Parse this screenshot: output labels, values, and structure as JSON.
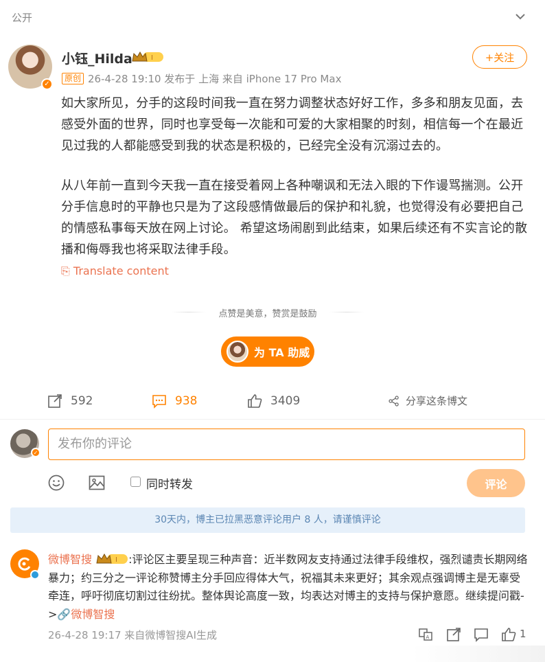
{
  "header": {
    "visibility": "公开"
  },
  "post": {
    "author": "小钰_Hilda",
    "follow_label": "+关注",
    "original_tag": "原创",
    "meta": "26-4-28 19:10  发布于 上海  来自 iPhone 17 Pro Max",
    "paragraphs": [
      "如大家所见，分手的这段时间我一直在努力调整状态好好工作，多多和朋友见面，去感受外面的世界，同时也享受每一次能和可爱的大家相聚的时刻，相信每一个在最近见过我的人都能感受到我的状态是积极的，已经完全没有沉溺过去的。",
      "从八年前一直到今天我一直在接受着网上各种嘲讽和无法入眼的下作谩骂揣测。公开分手信息时的平静也只是为了这段感情做最后的保护和礼貌，也觉得没有必要把自己的情感私事每天放在网上讨论。 希望这场闹剧到此结束，如果后续还有不实言论的散播和侮辱我也将采取法律手段。"
    ],
    "translate_label": "Translate content",
    "reward_text": "点赞是美意，赞赏是鼓励",
    "cheer_label": "为 TA 助威",
    "stats": {
      "reposts": "592",
      "comments": "938",
      "likes": "3409",
      "share_label": "分享这条博文"
    }
  },
  "composer": {
    "placeholder": "发布你的评论",
    "repost_label": "同时转发",
    "submit_label": "评论"
  },
  "notice": "30天内，博主已拉黑恶意评论用户 8 人，请谨慎评论",
  "ai_comment": {
    "name": "微博智搜",
    "text": ":评论区主要呈现三种声音：近半数网友支持通过法律手段维权，强烈谴责长期网络暴力；约三分之一评论称赞博主分手回应得体大气，祝福其未来更好；其余观点强调博主是无辜受牵连，呼吁彻底切割过往纷扰。整体舆论高度一致，均表达对博主的支持与保护意愿。继续提问戳->",
    "link_label": "微博智搜",
    "meta": "26-4-28 19:17  来自微博智搜AI生成",
    "likes": "1"
  },
  "colors": {
    "accent": "#ff8200",
    "link": "#eb7350",
    "notice_bg": "#e6f0fa",
    "notice_text": "#5b86b3"
  }
}
